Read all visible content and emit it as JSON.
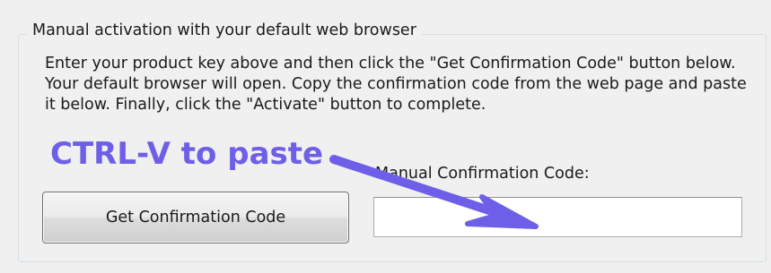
{
  "groupbox": {
    "title": "Manual activation with your default web browser",
    "instructions": "Enter your product key above and then click the \"Get Confirmation Code\" button below. Your default browser will open. Copy the confirmation code from the web page and paste it below. Finally, click the \"Activate\" button to complete."
  },
  "annotation": {
    "text": "CTRL-V to paste",
    "color": "#6e5fe8"
  },
  "confirmation": {
    "label": "Manual Confirmation Code:",
    "value": "",
    "placeholder": ""
  },
  "buttons": {
    "get_code_label": "Get Confirmation Code"
  }
}
